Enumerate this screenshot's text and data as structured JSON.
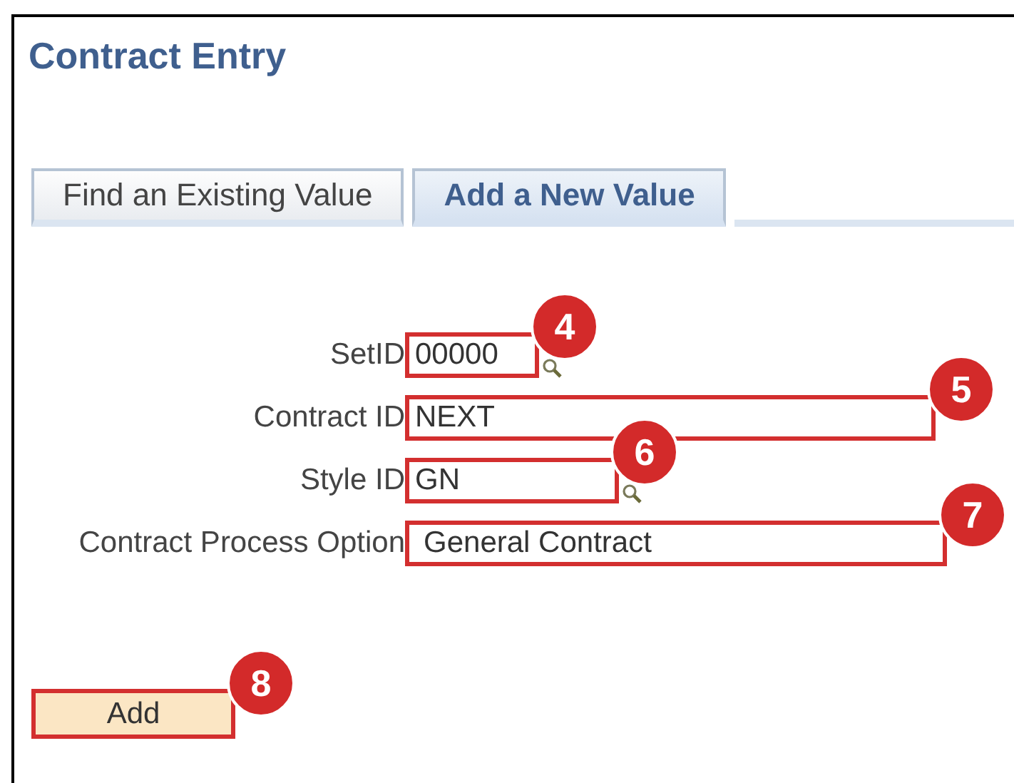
{
  "page": {
    "title": "Contract Entry"
  },
  "tabs": [
    {
      "label": "Find an Existing Value",
      "selected": false
    },
    {
      "label": "Add a New Value",
      "selected": true
    }
  ],
  "fields": [
    {
      "label": "SetID",
      "value": "00000",
      "kind": "lookup",
      "callout": "4"
    },
    {
      "label": "Contract ID",
      "value": "NEXT",
      "kind": "text",
      "callout": "5"
    },
    {
      "label": "Style ID",
      "value": "GN",
      "kind": "lookup",
      "callout": "6"
    },
    {
      "label": "Contract Process Option",
      "value": "General Contract",
      "kind": "select",
      "callout": "7"
    }
  ],
  "add_button": {
    "label": "Add",
    "callout": "8"
  }
}
